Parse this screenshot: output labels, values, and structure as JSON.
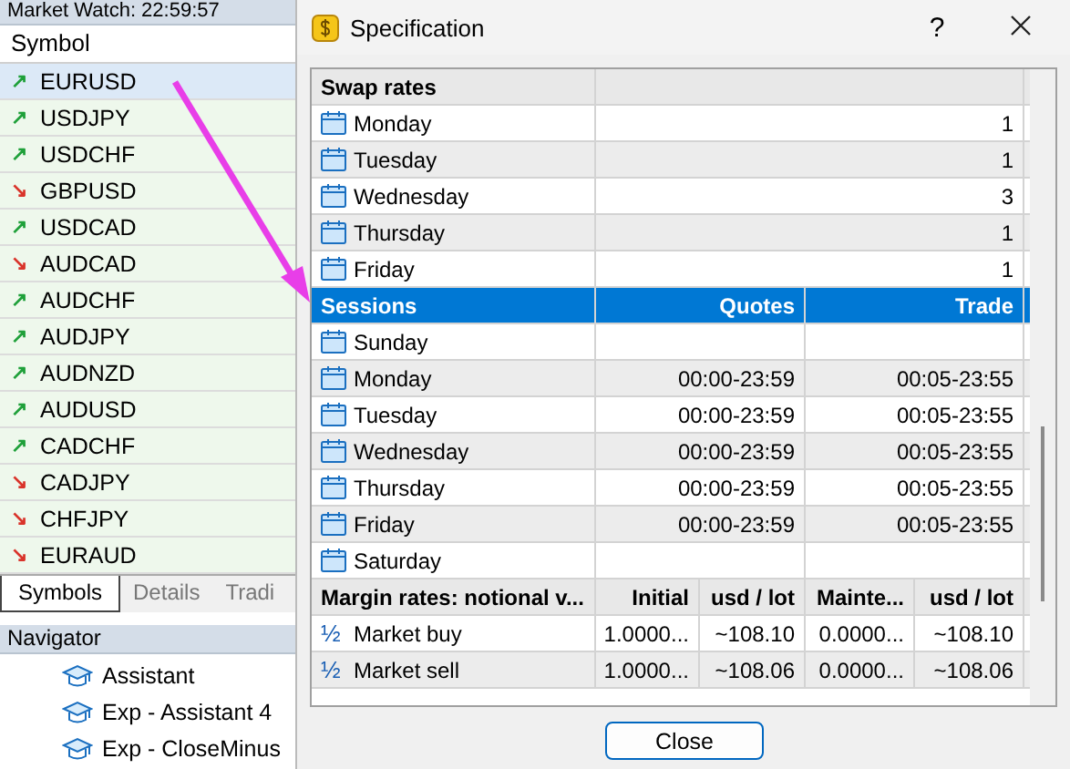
{
  "market_watch": {
    "title": "Market Watch: 22:59:57",
    "column": "Symbol",
    "symbols": [
      {
        "name": "EURUSD",
        "arrow": "↗",
        "color": "#1fa03a",
        "selected": true
      },
      {
        "name": "USDJPY",
        "arrow": "↗",
        "color": "#1fa03a",
        "selected": false
      },
      {
        "name": "USDCHF",
        "arrow": "↗",
        "color": "#1fa03a",
        "selected": false
      },
      {
        "name": "GBPUSD",
        "arrow": "↘",
        "color": "#d9342b",
        "selected": false
      },
      {
        "name": "USDCAD",
        "arrow": "↗",
        "color": "#1fa03a",
        "selected": false
      },
      {
        "name": "AUDCAD",
        "arrow": "↘",
        "color": "#d9342b",
        "selected": false
      },
      {
        "name": "AUDCHF",
        "arrow": "↗",
        "color": "#1fa03a",
        "selected": false
      },
      {
        "name": "AUDJPY",
        "arrow": "↗",
        "color": "#1fa03a",
        "selected": false
      },
      {
        "name": "AUDNZD",
        "arrow": "↗",
        "color": "#1fa03a",
        "selected": false
      },
      {
        "name": "AUDUSD",
        "arrow": "↗",
        "color": "#1fa03a",
        "selected": false
      },
      {
        "name": "CADCHF",
        "arrow": "↗",
        "color": "#1fa03a",
        "selected": false
      },
      {
        "name": "CADJPY",
        "arrow": "↘",
        "color": "#d9342b",
        "selected": false
      },
      {
        "name": "CHFJPY",
        "arrow": "↘",
        "color": "#d9342b",
        "selected": false
      },
      {
        "name": "EURAUD",
        "arrow": "↘",
        "color": "#d9342b",
        "selected": false
      }
    ],
    "tabs": [
      {
        "label": "Symbols",
        "selected": true
      },
      {
        "label": "Details",
        "selected": false
      },
      {
        "label": "Tradi",
        "selected": false
      }
    ]
  },
  "navigator": {
    "title": "Navigator",
    "items": [
      "Assistant",
      "Exp - Assistant  4",
      "Exp - CloseMinus"
    ]
  },
  "dialog": {
    "title": "Specification",
    "help": "?",
    "swap_rates": {
      "title": "Swap rates",
      "rows": [
        {
          "day": "Monday",
          "value": "1"
        },
        {
          "day": "Tuesday",
          "value": "1"
        },
        {
          "day": "Wednesday",
          "value": "3"
        },
        {
          "day": "Thursday",
          "value": "1"
        },
        {
          "day": "Friday",
          "value": "1"
        }
      ]
    },
    "sessions": {
      "title": "Sessions",
      "selected": true,
      "columns": [
        "Quotes",
        "Trade"
      ],
      "rows": [
        {
          "day": "Sunday"
        },
        {
          "day": "Monday",
          "quotes": "00:00-23:59",
          "trade": "00:05-23:55"
        },
        {
          "day": "Tuesday",
          "quotes": "00:00-23:59",
          "trade": "00:05-23:55"
        },
        {
          "day": "Wednesday",
          "quotes": "00:00-23:59",
          "trade": "00:05-23:55"
        },
        {
          "day": "Thursday",
          "quotes": "00:00-23:59",
          "trade": "00:05-23:55"
        },
        {
          "day": "Friday",
          "quotes": "00:00-23:59",
          "trade": "00:05-23:55"
        },
        {
          "day": "Saturday"
        }
      ]
    },
    "margin_rates": {
      "columns": [
        "Margin rates: notional v...",
        "Initial",
        "usd / lot",
        "Mainte...",
        "usd / lot"
      ],
      "rows": [
        {
          "icon_glyph": "½",
          "label": "Market buy",
          "initial": "1.0000...",
          "initial_usd": "~108.10",
          "maintenance": "0.0000...",
          "maintenance_usd": "~108.10"
        },
        {
          "icon_glyph": "½",
          "label": "Market sell",
          "initial": "1.0000...",
          "initial_usd": "~108.06",
          "maintenance": "0.0000...",
          "maintenance_usd": "~108.06"
        }
      ]
    },
    "close_button": "Close"
  }
}
